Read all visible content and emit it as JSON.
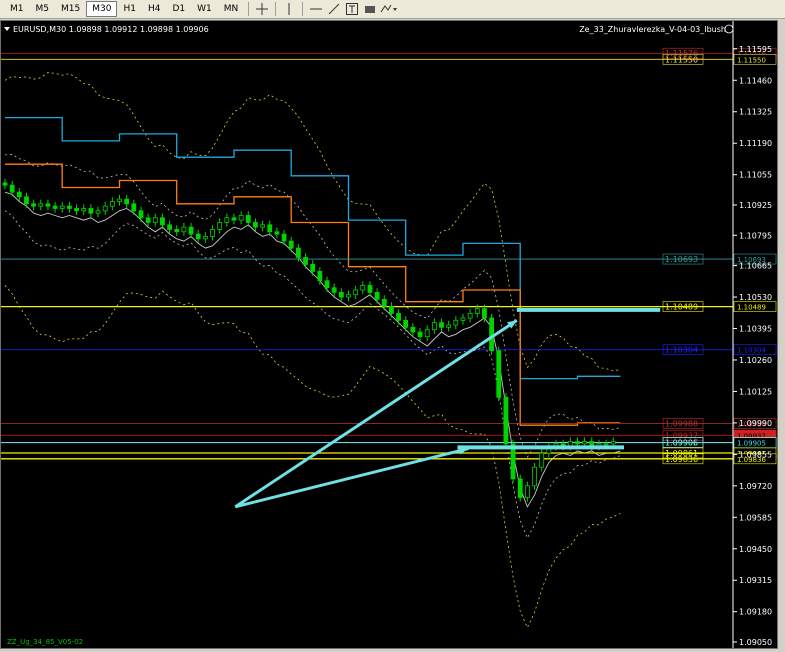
{
  "toolbar": {
    "timeframes": [
      "M1",
      "M5",
      "M15",
      "M30",
      "H1",
      "H4",
      "D1",
      "W1",
      "MN"
    ],
    "active_timeframe": "M30",
    "tools": [
      "crosshair-icon",
      "vertical-line-icon",
      "horizontal-line-icon",
      "trendline-icon",
      "text-label-icon",
      "rectangle-icon",
      "shapes-menu-icon"
    ]
  },
  "chart_data": {
    "type": "candlestick",
    "symbol_header": "EURUSD,M30  1.09898 1.09912 1.09898 1.09906",
    "indicator_label": "Ze_33_Zhuravlerezka_V-04-03_Ibush",
    "bottom_label": "ZZ_Ug_34_85_V05-02",
    "ylim": [
      1.0905,
      1.1168
    ],
    "y_ticks": [
      "1.11595",
      "1.11460",
      "1.11325",
      "1.11190",
      "1.11055",
      "1.10925",
      "1.10795",
      "1.10665",
      "1.10530",
      "1.10395",
      "1.10260",
      "1.10125",
      "1.09990",
      "1.09855",
      "1.09720",
      "1.09585",
      "1.09450",
      "1.09315",
      "1.09180",
      "1.09050"
    ],
    "horizontal_levels": [
      {
        "price": 1.11576,
        "label": "1.11576",
        "color": "#c03030"
      },
      {
        "price": 1.1155,
        "label": "1.11550",
        "color": "#e8e040"
      },
      {
        "price": 1.10693,
        "label": "1.10693",
        "color": "#30a0a0"
      },
      {
        "price": 1.10489,
        "label": "1.10489",
        "color": "#f0f000"
      },
      {
        "price": 1.10304,
        "label": "1.10304",
        "color": "#2020ff"
      },
      {
        "price": 1.09988,
        "label": "1.09988",
        "color": "#c03030"
      },
      {
        "price": 1.09937,
        "label": "1.09937",
        "color": "#d02020"
      },
      {
        "price": 1.09906,
        "label": "1.09906",
        "color": "#ffffff"
      },
      {
        "price": 1.09905,
        "label": "1.09905",
        "color": "#40e0e0"
      },
      {
        "price": 1.09861,
        "label": "1.09861",
        "color": "#f0f000"
      },
      {
        "price": 1.09836,
        "label": "1.09836",
        "color": "#f0f000"
      }
    ],
    "price_path": [
      1.1102,
      1.1101,
      1.1098,
      1.1096,
      1.1093,
      1.1092,
      1.1093,
      1.1092,
      1.1091,
      1.1092,
      1.1091,
      1.109,
      1.1091,
      1.1089,
      1.109,
      1.1092,
      1.1094,
      1.1095,
      1.1093,
      1.109,
      1.1087,
      1.1085,
      1.1087,
      1.1084,
      1.1082,
      1.1081,
      1.1083,
      1.108,
      1.1078,
      1.1079,
      1.1082,
      1.1085,
      1.1087,
      1.1086,
      1.1088,
      1.1085,
      1.1083,
      1.1084,
      1.1081,
      1.108,
      1.1077,
      1.1074,
      1.107,
      1.1067,
      1.1064,
      1.106,
      1.1057,
      1.1055,
      1.1053,
      1.1054,
      1.1056,
      1.1058,
      1.1055,
      1.1052,
      1.1049,
      1.1046,
      1.1043,
      1.104,
      1.1038,
      1.1036,
      1.1039,
      1.1042,
      1.104,
      1.1041,
      1.1043,
      1.1044,
      1.1046,
      1.1048,
      1.1044,
      1.103,
      1.101,
      1.099,
      1.0975,
      1.0967,
      1.0972,
      1.098,
      1.0986,
      1.0989,
      1.099,
      1.0989,
      1.0991,
      1.099,
      1.0991,
      1.0989,
      1.099,
      1.099,
      1.0991
    ],
    "arrows": [
      {
        "from": [
          0.318,
          1.0963
        ],
        "to": [
          0.707,
          1.1043
        ]
      },
      {
        "from": [
          0.318,
          1.0963
        ],
        "to": [
          0.64,
          1.0988
        ]
      }
    ],
    "highlight_bars": [
      {
        "price": 1.10475,
        "x_range": [
          0.707,
          0.905
        ]
      },
      {
        "price": 1.09885,
        "x_range": [
          0.625,
          0.855
        ]
      }
    ],
    "colors": {
      "background": "#000000",
      "candle": "#00d400",
      "axis_text": "#ffffff",
      "arrow": "#6fe0e6",
      "channel_upper": "#1fa8e0",
      "channel_lower": "#ff7f10",
      "bollinger": "#c0c0c0"
    }
  }
}
